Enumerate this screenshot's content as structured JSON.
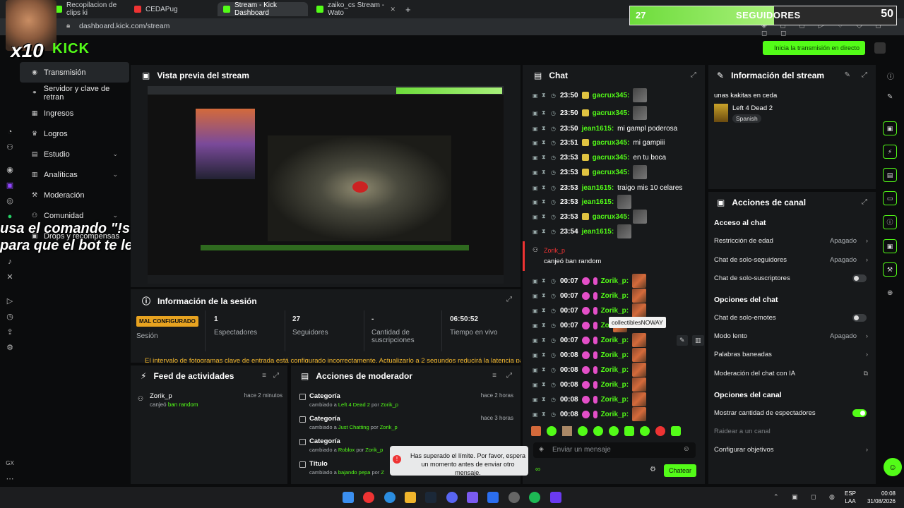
{
  "browser": {
    "tabs": [
      {
        "label": "Recopilacion de clips ki"
      },
      {
        "label": "CEDAPug"
      },
      {
        "label": "Stream - Kick Dashboard"
      },
      {
        "label": "zaiko_cs Stream - Wato"
      }
    ],
    "new_tab": "+",
    "url": "dashboard.kick.com/stream"
  },
  "overlay": {
    "followers_count": "27",
    "followers_label": "SEGUIDORES",
    "followers_goal": "50",
    "followers_progress": 0.54,
    "multiplier": "x10",
    "command_hint_line1": "usa el comando \"!s\"",
    "command_hint_line2": "para que el bot te lea"
  },
  "brand": {
    "logo": "KICK",
    "accent": "#53fc18"
  },
  "go_live_label": "Inicia la transmisión en directo",
  "nav": {
    "items": [
      {
        "label": "Transmisión",
        "active": true
      },
      {
        "label": "Servidor y clave de retran"
      },
      {
        "label": "Ingresos"
      },
      {
        "label": "Logros"
      },
      {
        "label": "Estudio"
      },
      {
        "label": "Analíticas"
      },
      {
        "label": "Moderación"
      },
      {
        "label": "Comunidad"
      },
      {
        "label": "Drops y recompensas"
      }
    ],
    "gx": "GX"
  },
  "preview": {
    "title": "Vista previa del stream"
  },
  "session": {
    "title": "Información de la sesión",
    "badge": "MAL CONFIGURADO",
    "stats": [
      {
        "label": "Sesión",
        "value": ""
      },
      {
        "label": "Espectadores",
        "value": "1"
      },
      {
        "label": "Seguidores",
        "value": "27"
      },
      {
        "label": "Cantidad de suscripciones",
        "value": "-"
      },
      {
        "label": "Tiempo en vivo",
        "value": "06:50:52"
      }
    ],
    "warning": "El intervalo de fotogramas clave de entrada está configurado incorrectamente. Actualizarlo a 2 segundos reducirá la latencia para"
  },
  "feed": {
    "title": "Feed de actividades",
    "items": [
      {
        "user": "Zorik_p",
        "action": "canjeó",
        "reward": "ban random",
        "time": "hace 2 minutos"
      }
    ]
  },
  "mod_actions": {
    "title": "Acciones de moderador",
    "items": [
      {
        "title": "Categoría",
        "verb": "cambiado a",
        "value": "Left 4 Dead 2",
        "by": "por",
        "user": "Zorik_p",
        "time": "hace 2 horas"
      },
      {
        "title": "Categoría",
        "verb": "cambiado a",
        "value": "Just Chatting",
        "by": "por",
        "user": "Zorik_p",
        "time": "hace 3 horas"
      },
      {
        "title": "Categoría",
        "verb": "cambiado a",
        "value": "Roblox",
        "by": "por",
        "user": "Zorik_p",
        "time": ""
      },
      {
        "title": "Título",
        "verb": "cambiado a",
        "value": "bajando pepa",
        "by": "por",
        "user": "Z",
        "time": ""
      }
    ]
  },
  "limit_toast": {
    "text": "Has superado el límite. Por favor, espera un momento antes de enviar otro mensaje."
  },
  "chat": {
    "title": "Chat",
    "messages": [
      {
        "time": "23:50",
        "user": "gacrux345:",
        "msg": "",
        "color": "#53fc18"
      },
      {
        "time": "23:50",
        "user": "gacrux345:",
        "msg": "",
        "color": "#53fc18"
      },
      {
        "time": "23:50",
        "user": "jean1615:",
        "msg": "mi gampl poderosa",
        "color": "#53fc18"
      },
      {
        "time": "23:51",
        "user": "gacrux345:",
        "msg": "mi gampiii",
        "color": "#53fc18"
      },
      {
        "time": "23:53",
        "user": "gacrux345:",
        "msg": "en tu boca",
        "color": "#53fc18"
      },
      {
        "time": "23:53",
        "user": "gacrux345:",
        "msg": "",
        "color": "#53fc18"
      },
      {
        "time": "23:53",
        "user": "jean1615:",
        "msg": "traigo mis 10 celares",
        "color": "#53fc18"
      },
      {
        "time": "23:53",
        "user": "jean1615:",
        "msg": "",
        "color": "#53fc18"
      },
      {
        "time": "23:53",
        "user": "gacrux345:",
        "msg": "",
        "color": "#53fc18"
      },
      {
        "time": "23:54",
        "user": "jean1615:",
        "msg": "",
        "color": "#53fc18"
      }
    ],
    "redeem": {
      "user": "Zorik_p",
      "text": "canjeó ban random"
    },
    "zorik_rows": [
      {
        "time": "00:07",
        "user": "Zorik_p:"
      },
      {
        "time": "00:07",
        "user": "Zorik_p:"
      },
      {
        "time": "00:07",
        "user": "Zorik_p:"
      },
      {
        "time": "00:07",
        "user": "Zo"
      },
      {
        "time": "00:07",
        "user": "Zorik_p:"
      },
      {
        "time": "00:08",
        "user": "Zorik_p:"
      },
      {
        "time": "00:08",
        "user": "Zorik_p:"
      },
      {
        "time": "00:08",
        "user": "Zorik_p:"
      },
      {
        "time": "00:08",
        "user": "Zorik_p:"
      },
      {
        "time": "00:08",
        "user": "Zorik_p:"
      }
    ],
    "tooltip": "collectiblesNOWAY",
    "input_placeholder": "Enviar un mensaje",
    "send_label": "Chatear"
  },
  "stream_info": {
    "title": "Información del stream",
    "stream_title": "unas kakitas en ceda",
    "category": "Left 4 Dead 2",
    "language": "Spanish"
  },
  "channel_actions": {
    "title": "Acciones de canal",
    "sections": [
      {
        "type": "header",
        "label": "Acceso al chat"
      },
      {
        "type": "select",
        "label": "Restricción de edad",
        "value": "Apagado"
      },
      {
        "type": "select",
        "label": "Chat de solo-seguidores",
        "value": "Apagado"
      },
      {
        "type": "toggle",
        "label": "Chat de solo-suscriptores",
        "on": false
      },
      {
        "type": "header",
        "label": "Opciones del chat"
      },
      {
        "type": "toggle",
        "label": "Chat de solo-emotes",
        "on": false
      },
      {
        "type": "select",
        "label": "Modo lento",
        "value": "Apagado"
      },
      {
        "type": "link",
        "label": "Palabras baneadas"
      },
      {
        "type": "external",
        "label": "Moderación del chat con IA"
      },
      {
        "type": "header",
        "label": "Opciones del canal"
      },
      {
        "type": "toggle",
        "label": "Mostrar cantidad de espectadores",
        "on": true
      },
      {
        "type": "disabled",
        "label": "Raidear a un canal"
      },
      {
        "type": "link",
        "label": "Configurar objetivos"
      }
    ]
  },
  "taskbar": {
    "lang_line1": "ESP",
    "lang_line2": "LAA",
    "time": "00:08",
    "date": "31/08/2026"
  }
}
